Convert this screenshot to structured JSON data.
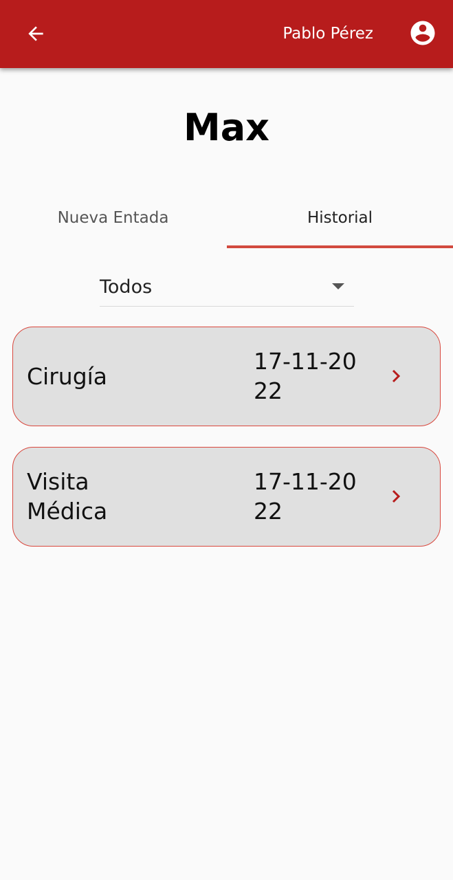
{
  "app_bar": {
    "back_icon": "arrow-back-icon",
    "user_name": "Pablo Pérez",
    "account_icon": "account-circle-icon",
    "background_color": "#b71c1c"
  },
  "pet": {
    "name": "Max"
  },
  "tabs": [
    {
      "label": "Nueva Entada",
      "selected": false
    },
    {
      "label": "Historial",
      "selected": true
    }
  ],
  "tab_indicator_color": "#d24a3f",
  "filter": {
    "selected": "Todos"
  },
  "records": [
    {
      "type": "Cirugía",
      "date": "17-11-2022",
      "icon": "chevron-right-icon"
    },
    {
      "type": "Visita Médica",
      "date": "17-11-2022",
      "icon": "chevron-right-icon"
    }
  ],
  "accent_color": "#b71c1c"
}
